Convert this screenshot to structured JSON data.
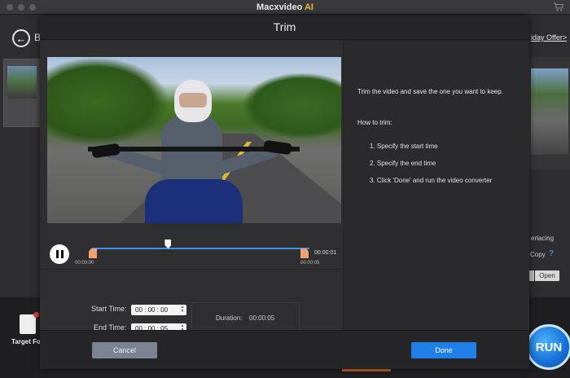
{
  "app": {
    "title_main": "Macxvideo",
    "title_ai": "AI"
  },
  "background": {
    "back_letter": "B",
    "offer_link": "iday Offer>",
    "deinterlacing_fragment": "erlacing",
    "copy_fragment": "Copy",
    "help_glyph": "?",
    "open_button": "Open",
    "target_format_label": "Target Fo",
    "run_button": "RUN"
  },
  "dialog": {
    "title": "Trim",
    "timeline": {
      "end_time_top": "00:00:01",
      "start_label": "00:00:00",
      "end_label": "00:00:05",
      "playhead_fraction": 0.35
    },
    "start_time_label": "Start Time:",
    "end_time_label": "End Time:",
    "start_time_value": "00 : 00 : 00",
    "end_time_value": "00 : 00 : 05",
    "duration_label": "Duration:",
    "duration_value": "00:00:05",
    "intro_text": "Trim the video and save the one you want to keep.",
    "howto_title": "How to trim:",
    "steps": [
      "1. Specify the start time",
      "2. Specify the end time",
      "3. Click 'Done' and run the video converter"
    ],
    "cancel_button": "Cancel",
    "done_button": "Done"
  },
  "colors": {
    "accent": "#1f7fe6",
    "track": "#3c8ee8",
    "handle": "#f0a070",
    "ai_badge": "#f2b53a"
  }
}
